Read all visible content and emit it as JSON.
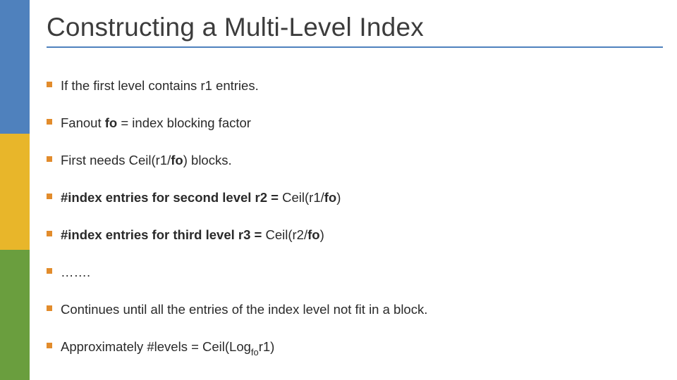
{
  "title": "Constructing a Multi-Level Index",
  "bullets": [
    {
      "plain_prefix": "If the first level contains r1 entries.",
      "bold_part": "",
      "plain_suffix": ""
    },
    {
      "plain_prefix": "Fanout ",
      "bold_part": "fo",
      "plain_suffix": " = index blocking factor"
    },
    {
      "plain_prefix": "First needs  Ceil(r1/",
      "bold_part": "fo",
      "plain_suffix": ")  blocks."
    },
    {
      "plain_prefix": "",
      "bold_part": "#index entries for second level r2 = ",
      "plain_suffix": "Ceil(r1/",
      "bold_tail": "fo",
      "tail": ")"
    },
    {
      "plain_prefix": "",
      "bold_part": "#index entries for third level r3 = ",
      "plain_suffix": "Ceil(r2/",
      "bold_tail": "fo",
      "tail": ")"
    },
    {
      "plain_prefix": "…….",
      "bold_part": "",
      "plain_suffix": ""
    },
    {
      "plain_prefix": "Continues until all the entries of the index level not fit in a block.",
      "bold_part": "",
      "plain_suffix": ""
    },
    {
      "plain_prefix": "Approximately #levels = Ceil(Log",
      "sub": "fo",
      "plain_suffix": "r1)"
    }
  ]
}
